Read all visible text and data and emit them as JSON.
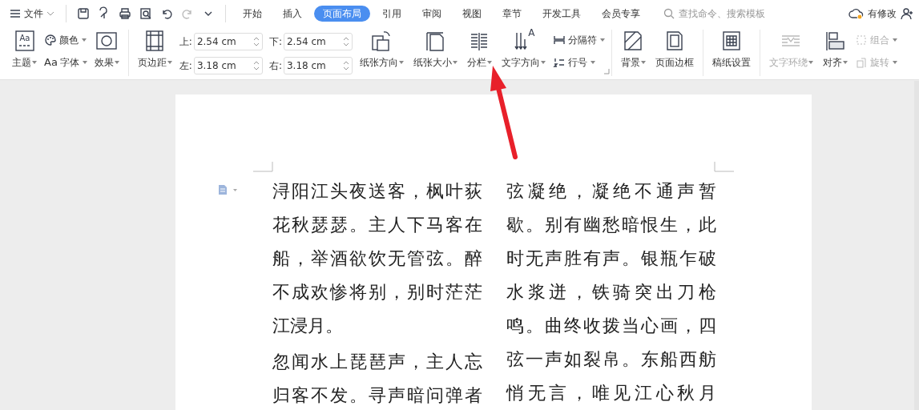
{
  "menu": {
    "label": "文件"
  },
  "tabs": [
    {
      "label": "开始",
      "selected": false
    },
    {
      "label": "插入",
      "selected": false
    },
    {
      "label": "页面布局",
      "selected": true
    },
    {
      "label": "引用",
      "selected": false
    },
    {
      "label": "审阅",
      "selected": false
    },
    {
      "label": "视图",
      "selected": false
    },
    {
      "label": "章节",
      "selected": false
    },
    {
      "label": "开发工具",
      "selected": false
    },
    {
      "label": "会员专享",
      "selected": false
    }
  ],
  "search": {
    "placeholder": "查找命令、搜索模板"
  },
  "status": {
    "label": "有修改"
  },
  "ribbon": {
    "groups": [
      {
        "items": [
          {
            "kind": "large",
            "icon_text": "Aa",
            "label": "主题",
            "caret": true,
            "disabled": false
          },
          {
            "kind": "stack",
            "rows": [
              {
                "label": "颜色",
                "caret": true,
                "disabled": false
              },
              {
                "prefix": "Aa",
                "label": "字体",
                "caret": true,
                "disabled": false
              }
            ]
          },
          {
            "kind": "large",
            "label": "效果",
            "caret": true,
            "disabled": false
          }
        ]
      },
      {
        "launcher": true,
        "items": [
          {
            "kind": "large",
            "label": "页边距",
            "caret": true,
            "disabled": false
          },
          {
            "kind": "spin",
            "fields": [
              {
                "label": "上:",
                "value": "2.54 cm"
              },
              {
                "label": "下:",
                "value": "2.54 cm"
              },
              {
                "label": "左:",
                "value": "3.18 cm"
              },
              {
                "label": "右:",
                "value": "3.18 cm"
              }
            ]
          },
          {
            "kind": "large",
            "label": "纸张方向",
            "caret": true,
            "disabled": false
          },
          {
            "kind": "large",
            "label": "纸张大小",
            "caret": true,
            "disabled": false
          },
          {
            "kind": "large",
            "label": "分栏",
            "caret": true,
            "disabled": false
          },
          {
            "kind": "large",
            "icon_text": "A",
            "label": "文字方向",
            "caret": true,
            "disabled": false
          },
          {
            "kind": "stack",
            "rows": [
              {
                "label": "分隔符",
                "caret": true,
                "disabled": false
              },
              {
                "label": "行号",
                "caret": true,
                "disabled": false
              }
            ]
          }
        ]
      },
      {
        "items": [
          {
            "kind": "large",
            "label": "背景",
            "caret": true,
            "disabled": false
          },
          {
            "kind": "large",
            "label": "页面边框",
            "caret": false,
            "disabled": false
          }
        ]
      },
      {
        "items": [
          {
            "kind": "large",
            "label": "稿纸设置",
            "caret": false,
            "disabled": false
          }
        ]
      },
      {
        "items": [
          {
            "kind": "large",
            "label": "文字环绕",
            "caret": true,
            "disabled": true
          },
          {
            "kind": "large",
            "label": "对齐",
            "caret": true,
            "disabled": false
          },
          {
            "kind": "stack",
            "rows": [
              {
                "label": "组合",
                "caret": true,
                "disabled": true
              },
              {
                "label": "旋转",
                "caret": true,
                "disabled": true
              }
            ]
          }
        ]
      }
    ]
  },
  "document": {
    "columns": [
      {
        "paragraphs": [
          {
            "lines": [
              "浔阳江头夜送客，枫叶荻",
              "花秋瑟瑟。主人下马客在",
              "船，举酒欲饮无管弦。醉",
              "不成欢惨将别，别时茫茫",
              "江浸月。"
            ]
          },
          {
            "lines": [
              "忽闻水上琵琶声，主人忘",
              "归客不发。寻声暗问弹者"
            ]
          }
        ]
      },
      {
        "paragraphs": [
          {
            "lines": [
              "弦凝绝，凝绝不通声暂",
              "歇。别有幽愁暗恨生，此",
              "时无声胜有声。银瓶乍破",
              "水浆迸，铁骑突出刀枪",
              "鸣。曲终收拨当心画，四",
              "弦一声如裂帛。东船西舫",
              "悄无言，唯见江心秋月"
            ]
          }
        ]
      }
    ]
  },
  "annotation": {
    "arrow": true
  }
}
